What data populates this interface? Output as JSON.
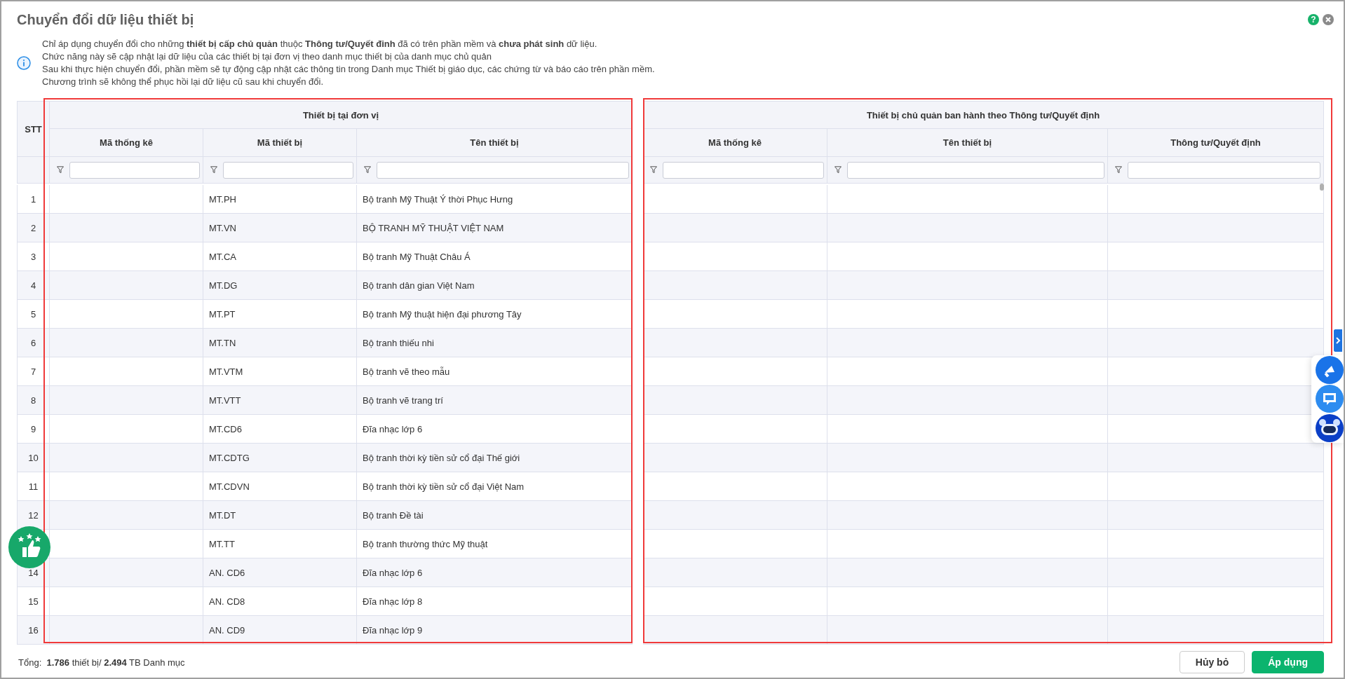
{
  "dialog": {
    "title": "Chuyển đổi dữ liệu thiết bị",
    "help_icon": "?"
  },
  "notes": [
    "Chỉ áp dụng chuyển đổi cho những **thiết bị cấp chủ quản** thuộc **Thông tư/Quyết đinh** đã có trên phần mềm và **chưa phát sinh** dữ liệu.",
    "Chức năng này sẽ cập nhật lại dữ liệu của các thiết bị tại đơn vị theo danh mục thiết bị của danh mục chủ quản",
    "Sau khi thực hiện chuyển đổi, phần mềm sẽ tự động cập nhật các thông tin trong Danh mục Thiết bị giáo dục, các chứng từ và báo cáo trên phần mềm.",
    "Chương trình sẽ không thể phục hồi lại dữ liệu cũ sau khi chuyển đổi."
  ],
  "table": {
    "stt_header": "STT",
    "left_group": "Thiết bị tại đơn vị",
    "right_group": "Thiết bị chủ quản ban hành theo Thông tư/Quyết định",
    "left_columns": [
      "Mã thống kê",
      "Mã thiết bị",
      "Tên thiết bị"
    ],
    "right_columns": [
      "Mã thống kê",
      "Tên thiết bị",
      "Thông tư/Quyết định"
    ],
    "rows": [
      {
        "stt": "1",
        "ma_thiet_bi": "MT.PH",
        "ten_thiet_bi": "Bộ tranh Mỹ Thuật Ý thời Phục Hưng"
      },
      {
        "stt": "2",
        "ma_thiet_bi": "MT.VN",
        "ten_thiet_bi": "BỘ TRANH MỸ THUẬT VIỆT NAM"
      },
      {
        "stt": "3",
        "ma_thiet_bi": "MT.CA",
        "ten_thiet_bi": "Bộ tranh Mỹ Thuật Châu Á"
      },
      {
        "stt": "4",
        "ma_thiet_bi": "MT.DG",
        "ten_thiet_bi": "Bộ tranh dân gian Việt Nam"
      },
      {
        "stt": "5",
        "ma_thiet_bi": "MT.PT",
        "ten_thiet_bi": "Bộ tranh Mỹ thuật hiện đại phương Tây"
      },
      {
        "stt": "6",
        "ma_thiet_bi": "MT.TN",
        "ten_thiet_bi": "Bộ tranh thiếu nhi"
      },
      {
        "stt": "7",
        "ma_thiet_bi": "MT.VTM",
        "ten_thiet_bi": "Bộ tranh vẽ theo mẫu"
      },
      {
        "stt": "8",
        "ma_thiet_bi": "MT.VTT",
        "ten_thiet_bi": "Bộ tranh vẽ trang trí"
      },
      {
        "stt": "9",
        "ma_thiet_bi": "MT.CD6",
        "ten_thiet_bi": "Đĩa nhạc lớp 6"
      },
      {
        "stt": "10",
        "ma_thiet_bi": "MT.CDTG",
        "ten_thiet_bi": "Bộ tranh thời kỳ tiền sử cổ đại Thế giới"
      },
      {
        "stt": "11",
        "ma_thiet_bi": "MT.CDVN",
        "ten_thiet_bi": "Bộ tranh thời kỳ tiền sử cổ đại Việt Nam"
      },
      {
        "stt": "12",
        "ma_thiet_bi": "MT.DT",
        "ten_thiet_bi": "Bộ tranh Đề tài"
      },
      {
        "ma_thiet_bi": "MT.TT",
        "ten_thiet_bi": "Bộ tranh thường thức Mỹ thuật"
      },
      {
        "stt": "14",
        "ma_thiet_bi": "AN. CD6",
        "ten_thiet_bi": "Đĩa nhạc lớp 6"
      },
      {
        "stt": "15",
        "ma_thiet_bi": "AN. CD8",
        "ten_thiet_bi": "Đĩa nhạc lớp 8"
      },
      {
        "stt": "16",
        "ma_thiet_bi": "AN. CD9",
        "ten_thiet_bi": "Đĩa nhạc lớp 9"
      }
    ]
  },
  "summary": "Tổng:  **1.786** thiết bị/ **2.494** TB Danh mục",
  "buttons": [
    {
      "label": "Hủy bỏ",
      "kind": "secondary"
    },
    {
      "label": "Áp dụng",
      "kind": "primary"
    }
  ]
}
